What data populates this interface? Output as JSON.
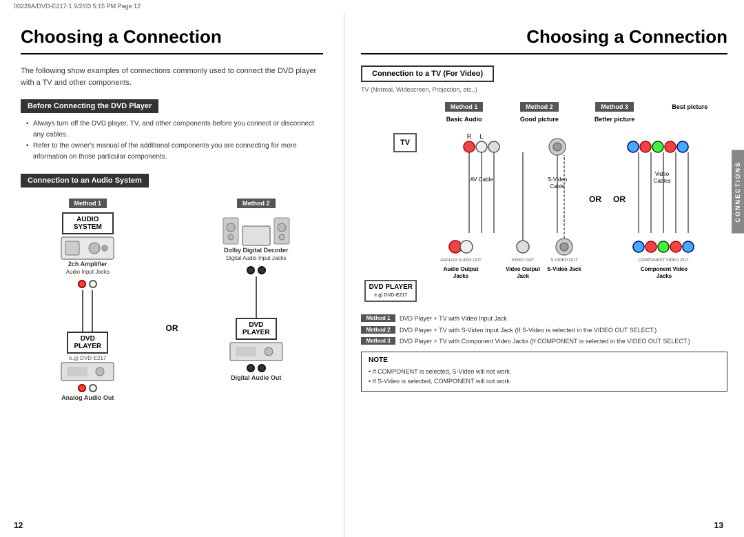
{
  "topbar": {
    "text": "00228A/DVD-E217-1   9/2/03  5:15 PM   Page 12"
  },
  "left": {
    "title": "Choosing a Connection",
    "intro": "The following show examples of connections commonly used to connect the DVD player\nwith a TV and other components.",
    "section1": {
      "label": "Before Connecting the DVD Player",
      "bullets": [
        "Always turn off the DVD player, TV, and other components before you connect or disconnect any cables.",
        "Refer to the owner's manual of the additional components you are connecting for more information on those particular components."
      ]
    },
    "section2": {
      "label": "Connection to an Audio System",
      "method1_label": "Method 1",
      "method2_label": "Method 2",
      "method1_device": "2ch Amplifier",
      "method1_jacks": "Audio Input Jacks",
      "method2_device": "Dolby Digital Decoder",
      "method2_jacks": "Digital Audio Input Jacks",
      "audio_system": "AUDIO\nSYSTEM",
      "dvd_player": "DVD\nPLAYER",
      "eg_label": "e.g) DVD-E217",
      "or_label": "OR",
      "analog_out": "Analog Audio Out",
      "digital_out": "Digital Audio Out"
    },
    "page_number": "12"
  },
  "right": {
    "title": "Choosing a Connection",
    "connection_tv_label": "Connection to a TV (For Video)",
    "tv_subtitle": "TV (Normal, Widescreen, Projection, etc..)",
    "method1_label": "Method 1",
    "method2_label": "Method 2",
    "method3_label": "Method 3",
    "basic_audio": "Basic Audio",
    "good_picture": "Good\npicture",
    "better_picture": "Better\npicture",
    "best_picture": "Best\npicture",
    "tv_label": "TV",
    "dvd_player_label": "DVD\nPLAYER",
    "eg_label": "e.g) DVD-E217",
    "av_cable": "AV Cable",
    "s_video_cable": "S-Video\nCable",
    "video_cables": "Video\nCables",
    "or1": "OR",
    "or2": "OR",
    "audio_output": "Audio Output\nJacks",
    "video_output": "Video Output\nJack",
    "s_video_jack": "S-Video Jack",
    "component_video": "Component Video\nJacks",
    "legend": [
      {
        "badge": "Method 1",
        "text": "DVD Player + TV with Video Input Jack"
      },
      {
        "badge": "Method 2",
        "text": "DVD Player + TV with S-Video Input Jack\n(If S-Video is selected in the VIDEO OUT SELECT.)"
      },
      {
        "badge": "Method 3",
        "text": "DVD Player + TV with Component Video Jacks\n(If COMPONENT is selected in the VIDEO OUT SELECT.)"
      }
    ],
    "note_header": "NOTE",
    "note_bullets": [
      "If COMPONENT is selected, S-Video will not work.",
      "If S-Video is selected, COMPONENT will not work."
    ],
    "connections_tab": "CONNECTIONS",
    "page_number": "13"
  }
}
